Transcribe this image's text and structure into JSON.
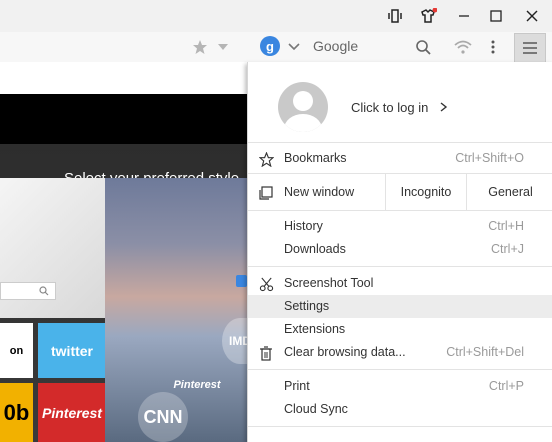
{
  "search": {
    "engine_label": "Google"
  },
  "page": {
    "heading": "Select your preferred style"
  },
  "tiles": {
    "twitter": "twitter",
    "pinterest": "Pinterest",
    "partial_top": "on",
    "partial_bottom": "0b",
    "cnn": "CNN",
    "photo_pinterest": "Pinterest",
    "photo_imdb": "IMD"
  },
  "menu": {
    "login": "Click to log in",
    "bookmarks": {
      "label": "Bookmarks",
      "shortcut": "Ctrl+Shift+O"
    },
    "new_window": {
      "label": "New window",
      "incognito": "Incognito",
      "general": "General"
    },
    "history": {
      "label": "History",
      "shortcut": "Ctrl+H"
    },
    "downloads": {
      "label": "Downloads",
      "shortcut": "Ctrl+J"
    },
    "screenshot": {
      "label": "Screenshot Tool"
    },
    "settings": {
      "label": "Settings"
    },
    "extensions": {
      "label": "Extensions"
    },
    "clear": {
      "label": "Clear browsing data...",
      "shortcut": "Ctrl+Shift+Del"
    },
    "print": {
      "label": "Print",
      "shortcut": "Ctrl+P"
    },
    "cloud_sync": {
      "label": "Cloud Sync"
    }
  },
  "colors": {
    "accent_blue": "#3a86e0",
    "notify_red": "#e53935"
  }
}
